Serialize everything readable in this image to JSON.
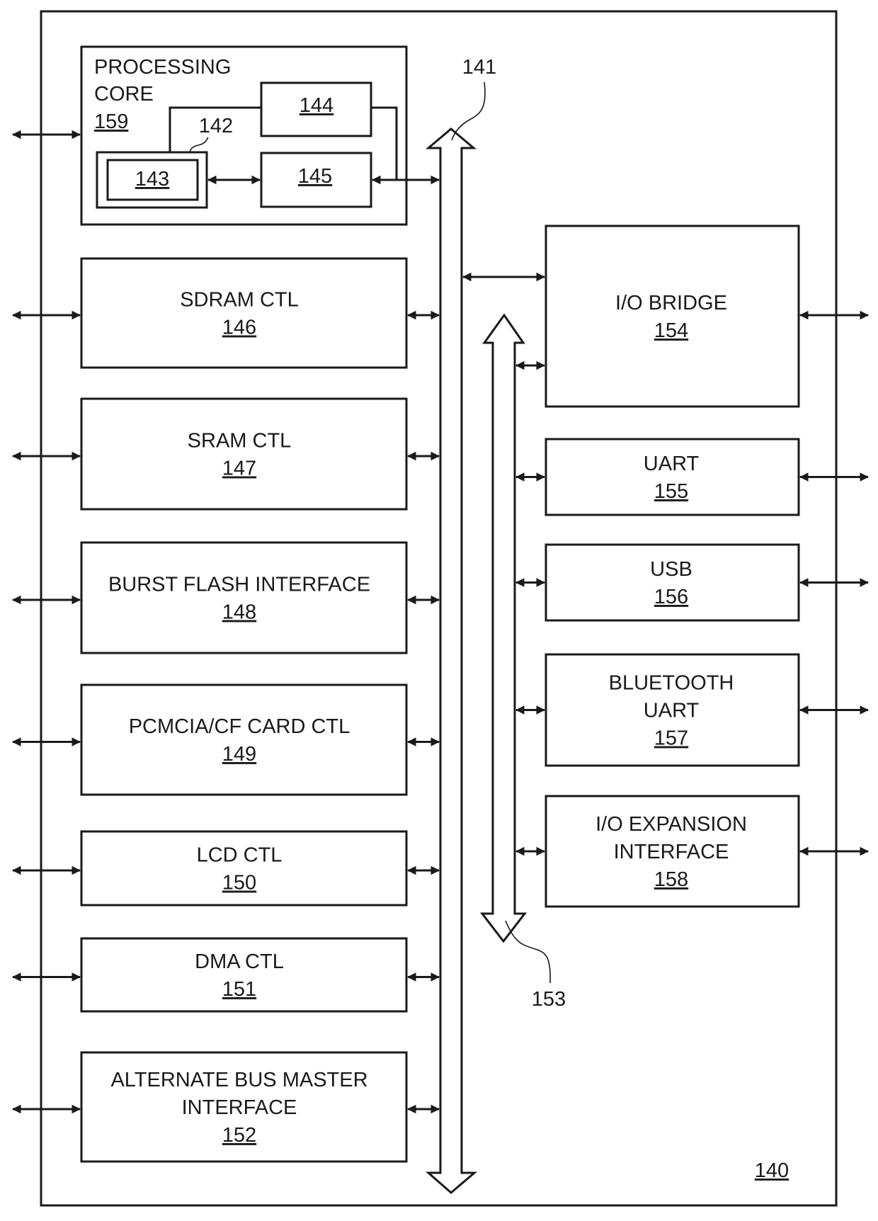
{
  "figure": {
    "system_ref": "140",
    "bus_main_ref": "141",
    "bus_peripheral_ref": "153",
    "processing_core": {
      "title_lines": [
        "PROCESSING",
        "CORE"
      ],
      "ref": "159",
      "sub_blocks": {
        "b142": "142",
        "b143": "143",
        "b144": "144",
        "b145": "145"
      }
    },
    "left_blocks": [
      {
        "lines": [
          "SDRAM CTL"
        ],
        "ref": "146"
      },
      {
        "lines": [
          "SRAM CTL"
        ],
        "ref": "147"
      },
      {
        "lines": [
          "BURST FLASH INTERFACE"
        ],
        "ref": "148"
      },
      {
        "lines": [
          "PCMCIA/CF CARD CTL"
        ],
        "ref": "149"
      },
      {
        "lines": [
          "LCD CTL"
        ],
        "ref": "150"
      },
      {
        "lines": [
          "DMA CTL"
        ],
        "ref": "151"
      },
      {
        "lines": [
          "ALTERNATE BUS MASTER",
          "INTERFACE"
        ],
        "ref": "152"
      }
    ],
    "right_blocks": [
      {
        "lines": [
          "I/O BRIDGE"
        ],
        "ref": "154"
      },
      {
        "lines": [
          "UART"
        ],
        "ref": "155"
      },
      {
        "lines": [
          "USB"
        ],
        "ref": "156"
      },
      {
        "lines": [
          "BLUETOOTH",
          "UART"
        ],
        "ref": "157"
      },
      {
        "lines": [
          "I/O EXPANSION",
          "INTERFACE"
        ],
        "ref": "158"
      }
    ]
  }
}
